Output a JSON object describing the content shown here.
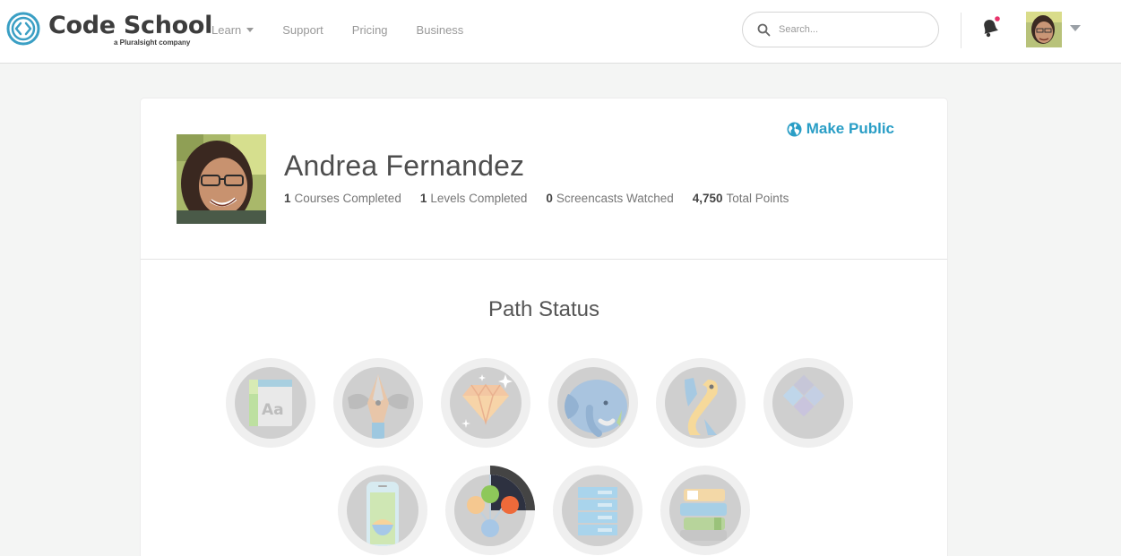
{
  "header": {
    "logo_text": "Code School",
    "logo_sub": "a Pluralsight company",
    "nav": [
      {
        "label": "Learn",
        "dropdown": true
      },
      {
        "label": "Support"
      },
      {
        "label": "Pricing"
      },
      {
        "label": "Business"
      }
    ],
    "search": {
      "placeholder": "Search..."
    },
    "has_notification": true
  },
  "profile": {
    "make_public_label": "Make Public",
    "name": "Andrea Fernandez",
    "stats": [
      {
        "value": "1",
        "label": "Courses Completed"
      },
      {
        "value": "1",
        "label": "Levels Completed"
      },
      {
        "value": "0",
        "label": "Screencasts Watched"
      },
      {
        "value": "4,750",
        "label": "Total Points"
      }
    ]
  },
  "path_status": {
    "title": "Path Status",
    "badges": [
      {
        "icon": "html-css-path-icon",
        "text": "Aa"
      },
      {
        "icon": "design-pen-path-icon"
      },
      {
        "icon": "ruby-gem-path-icon"
      },
      {
        "icon": "php-elephant-path-icon"
      },
      {
        "icon": "python-path-icon"
      },
      {
        "icon": "javascript-diamond-path-icon"
      },
      {
        "icon": "ios-phone-path-icon"
      },
      {
        "icon": "git-branch-path-icon",
        "progress": 0.25
      },
      {
        "icon": "database-server-path-icon"
      },
      {
        "icon": "electives-books-path-icon"
      }
    ]
  },
  "colors": {
    "accent": "#2a9ec6",
    "notification_dot": "#e8336b",
    "logo": "#3a9fc4"
  }
}
